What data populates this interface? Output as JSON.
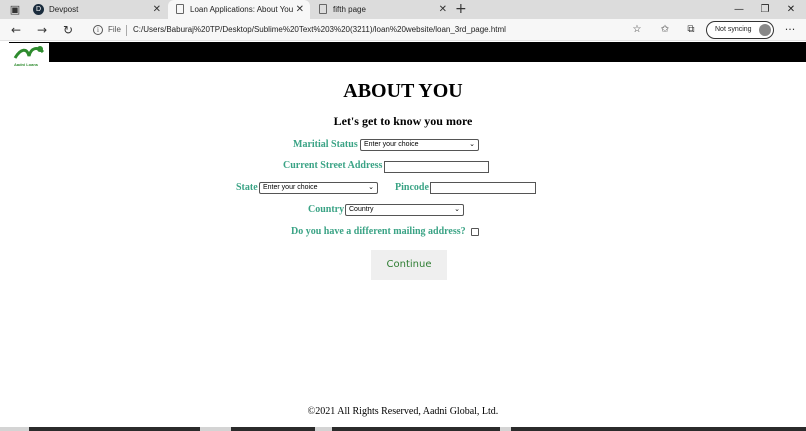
{
  "tabs": [
    {
      "title": "Devpost",
      "fav": "D"
    },
    {
      "title": "Loan Applications: About You",
      "fav": ""
    },
    {
      "title": "fifth page",
      "fav": ""
    }
  ],
  "address": {
    "file_label": "File",
    "url": "C:/Users/Baburaj%20TP/Desktop/Sublime%20Text%203%20(3211)/loan%20website/loan_3rd_page.html"
  },
  "sync_label": "Not syncing",
  "logo_text": "Aadni Loans",
  "page": {
    "heading": "ABOUT YOU",
    "subheading": "Let's get to know you more",
    "marital_label": "Maritial Status",
    "marital_value": "Enter your choice",
    "street_label": "Current Street Address",
    "state_label": "State",
    "state_value": "Enter your choice",
    "pincode_label": "Pincode",
    "country_label": "Country",
    "country_value": "Country",
    "mailing_label": "Do you have a different mailing address?",
    "continue_label": "Continue",
    "footer": "©2021 All Rights Reserved, Aadni Global, Ltd."
  },
  "colors": {
    "label_green": "#3aa385",
    "button_text": "#2e7d32",
    "header_bar": "#000000"
  }
}
